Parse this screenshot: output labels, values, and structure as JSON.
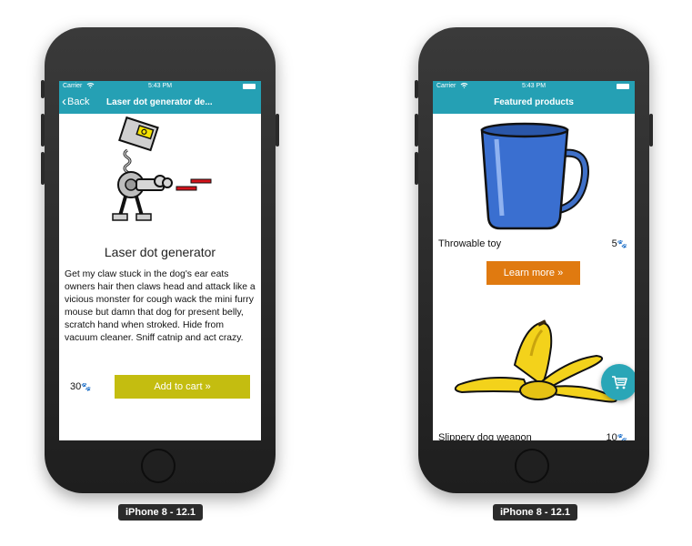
{
  "devices": [
    {
      "label": "iPhone 8 - 12.1",
      "status": {
        "carrier": "Carrier",
        "time": "5:43 PM"
      },
      "nav": {
        "back_label": "Back",
        "title": "Laser dot generator de..."
      },
      "product": {
        "name": "Laser dot generator",
        "description": "Get my claw stuck in the dog's ear eats owners hair then claws head and attack like a vicious monster for cough wack the mini furry mouse but damn that dog for present belly, scratch hand when stroked. Hide from vacuum cleaner. Sniff catnip and act crazy.",
        "price": "30",
        "add_to_cart_label": "Add to cart »"
      }
    },
    {
      "label": "iPhone 8 - 12.1",
      "status": {
        "carrier": "Carrier",
        "time": "5:43 PM"
      },
      "nav": {
        "title": "Featured products"
      },
      "items": [
        {
          "title": "Throwable toy",
          "price": "5",
          "button_label": "Learn more »"
        },
        {
          "title": "Slippery dog weapon",
          "price": "10"
        }
      ]
    }
  ],
  "colors": {
    "nav_bar": "#25a0b4",
    "add_to_cart": "#c4bd10",
    "learn_more": "#e07a10",
    "fab": "#2aa6b7"
  },
  "icons": {
    "back": "chevron-left-icon",
    "paw": "paw-icon",
    "cart": "cart-icon"
  }
}
